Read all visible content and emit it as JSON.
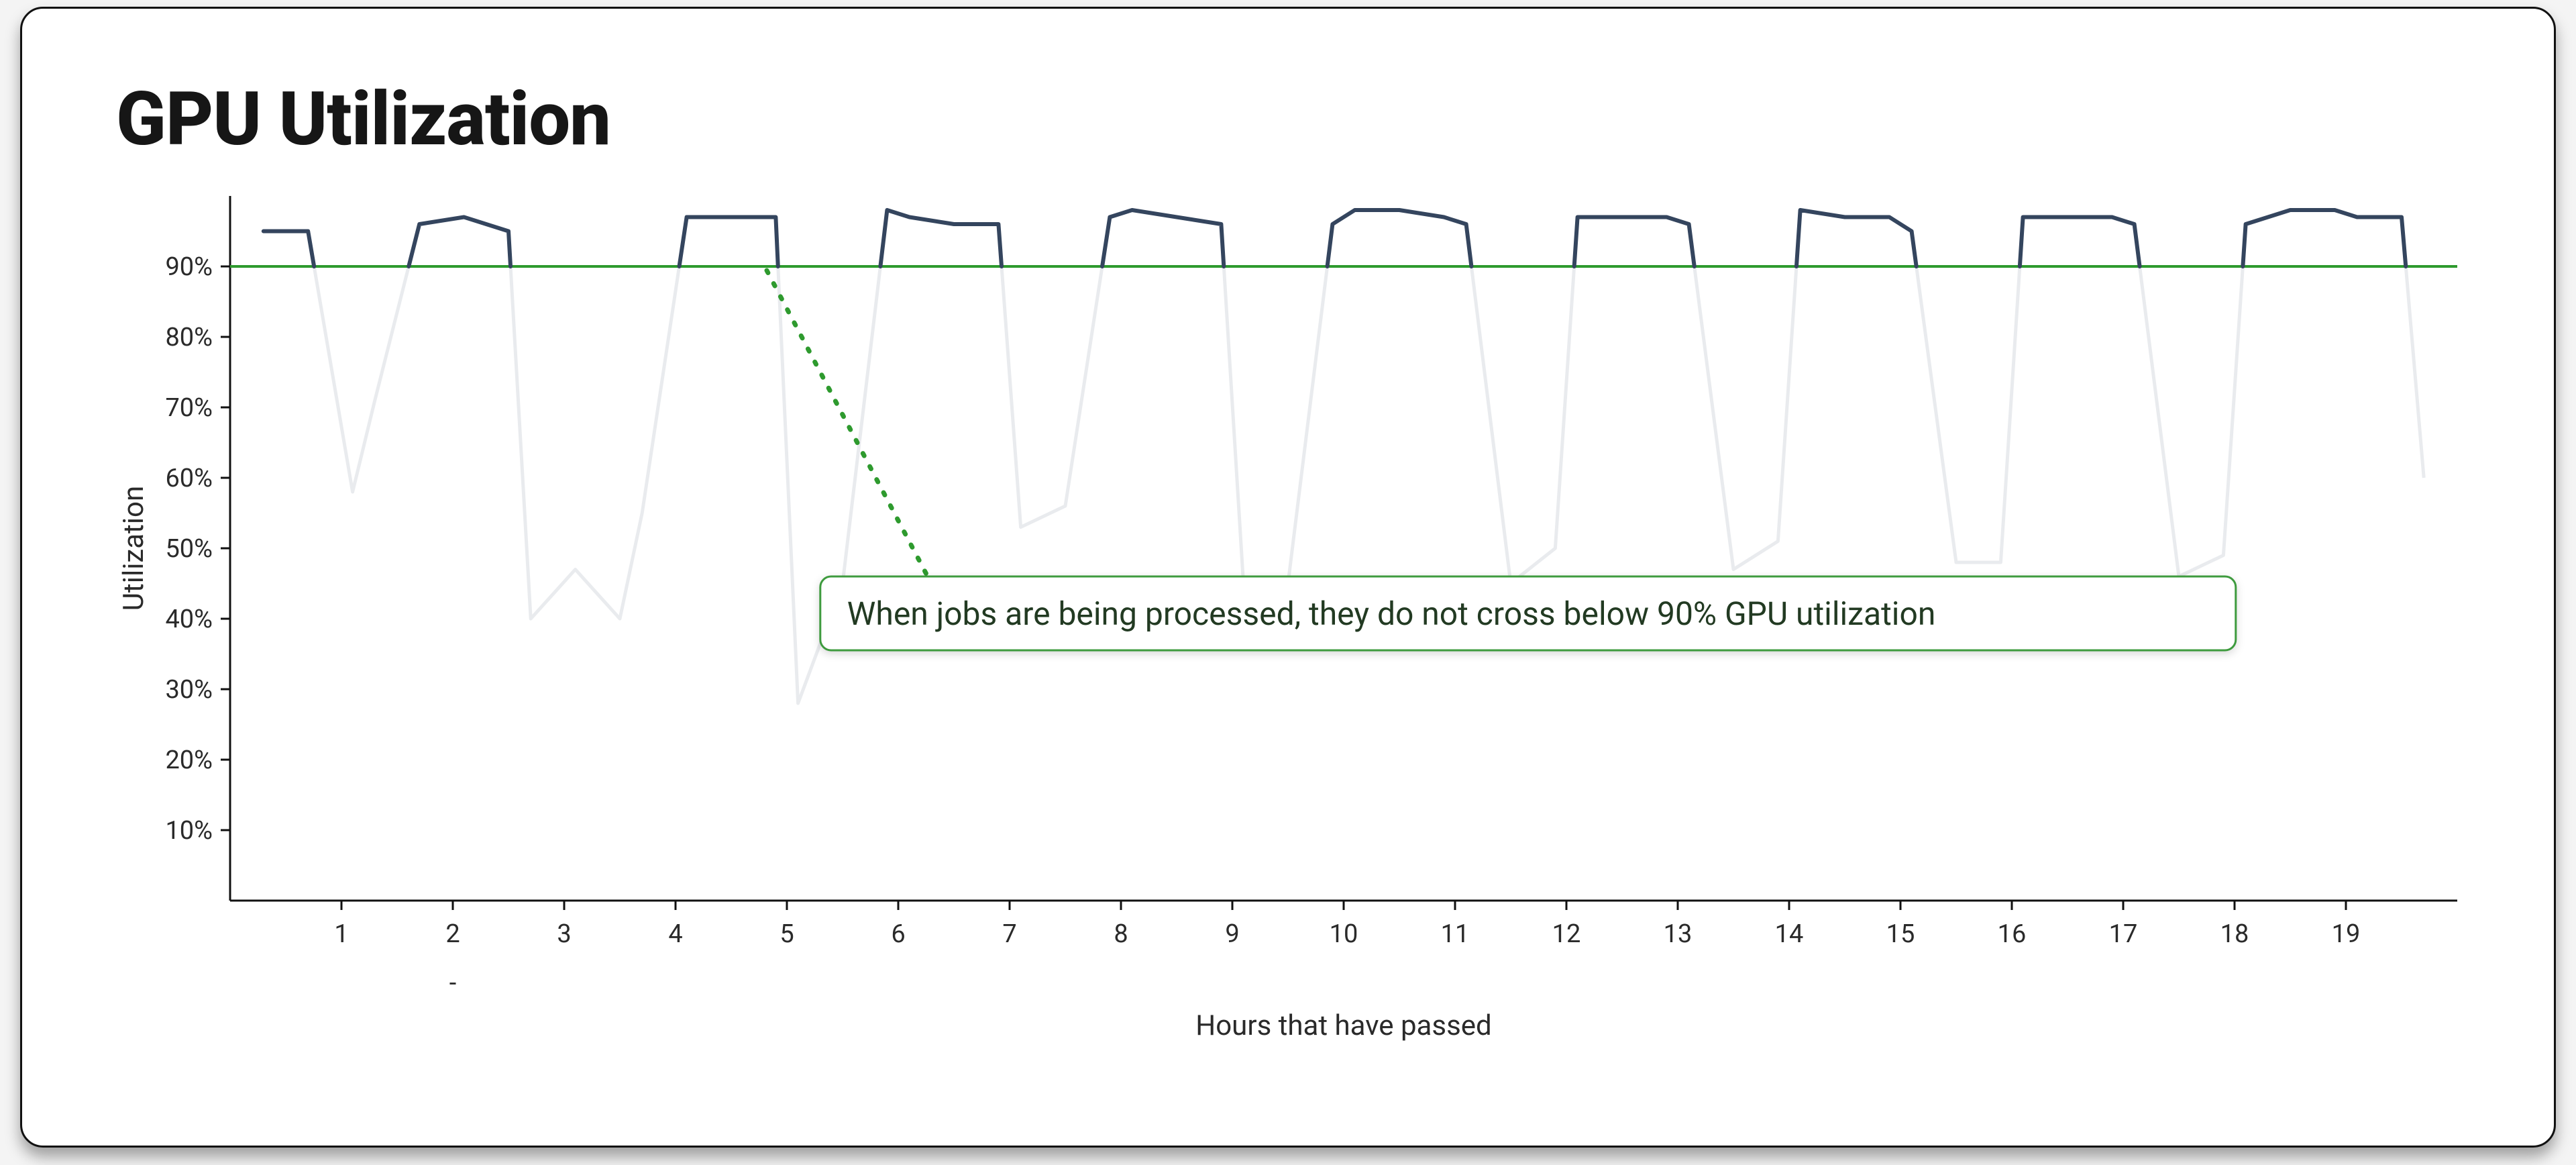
{
  "title": "GPU Utilization",
  "annotation": "When jobs are being processed, they do not cross below 90% GPU utilization",
  "xlabel": "Hours that have passed",
  "ylabel": "Utilization",
  "extra_tick": "-",
  "chart_data": {
    "type": "line",
    "title": "GPU Utilization",
    "xlabel": "Hours that have passed",
    "ylabel": "Utilization",
    "ylim": [
      0,
      100
    ],
    "xlim": [
      0,
      20
    ],
    "threshold": 90,
    "y_ticks": [
      10,
      20,
      30,
      40,
      50,
      60,
      70,
      80,
      90
    ],
    "x_ticks": [
      1,
      2,
      3,
      4,
      5,
      6,
      7,
      8,
      9,
      10,
      11,
      12,
      13,
      14,
      15,
      16,
      17,
      18,
      19
    ],
    "series": [
      {
        "name": "GPU Utilization",
        "x": [
          0.3,
          0.7,
          1.1,
          1.3,
          1.7,
          2.1,
          2.5,
          2.7,
          3.1,
          3.5,
          3.7,
          4.1,
          4.5,
          4.9,
          5.1,
          5.5,
          5.9,
          6.1,
          6.5,
          6.9,
          7.1,
          7.5,
          7.9,
          8.1,
          8.5,
          8.9,
          9.1,
          9.5,
          9.9,
          10.1,
          10.5,
          10.9,
          11.1,
          11.5,
          11.9,
          12.1,
          12.5,
          12.9,
          13.1,
          13.5,
          13.9,
          14.1,
          14.5,
          14.9,
          15.1,
          15.5,
          15.9,
          16.1,
          16.5,
          16.9,
          17.1,
          17.5,
          17.9,
          18.1,
          18.5,
          18.9,
          19.1,
          19.5,
          19.7
        ],
        "values": [
          95,
          95,
          58,
          71,
          96,
          97,
          95,
          40,
          47,
          40,
          55,
          97,
          97,
          97,
          28,
          45,
          98,
          97,
          96,
          96,
          53,
          56,
          97,
          98,
          97,
          96,
          45,
          45,
          96,
          98,
          98,
          97,
          96,
          45,
          50,
          97,
          97,
          97,
          96,
          47,
          51,
          98,
          97,
          97,
          95,
          48,
          48,
          97,
          97,
          97,
          96,
          46,
          49,
          96,
          98,
          98,
          97,
          97,
          60
        ]
      }
    ]
  }
}
